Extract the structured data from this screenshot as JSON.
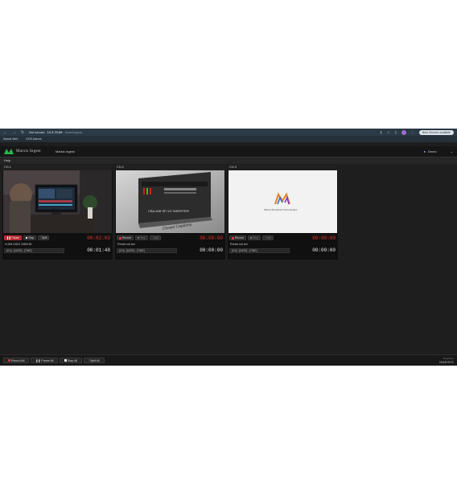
{
  "browser": {
    "nav_icons": [
      "back-icon",
      "forward-icon",
      "reload-icon"
    ],
    "security_text": "Not secure",
    "host": "10.3.70.69",
    "path": "/ltuse/ingest",
    "zoom_icon": "key-icon",
    "update_label": "New Chrome available",
    "bookmarks": [
      "Marsis Web",
      "DHS Alarms"
    ]
  },
  "app": {
    "brand": "Marsis Ingest",
    "title": "Marsis Ingest",
    "user": "Demo",
    "menu": "Help"
  },
  "channels": [
    {
      "title": "CH-1",
      "record_label": "Pause",
      "stop_label": "Stop",
      "split_label": "Split",
      "timer": "00:02:03",
      "preset": "H.264 HIGH 1080i 50",
      "format": "[CH] - [DATE] - [TIME]",
      "elapsed": "00:01:48",
      "recording": true
    },
    {
      "title": "CH-2",
      "record_label": "Record",
      "stop_label": "Stop",
      "split_label": "Split",
      "timer": "00:00:00",
      "preset": "Preset not set",
      "format": "[CH] - [DATE] - [TIME]",
      "elapsed": "00:00:00",
      "recording": false
    },
    {
      "title": "CH-3",
      "record_label": "Record",
      "stop_label": "Stop",
      "split_label": "Split",
      "timer": "00:00:00",
      "preset": "Preset not set",
      "format": "[CH] - [DATE] - [TIME]",
      "elapsed": "00:00:00",
      "recording": false
    }
  ],
  "previews": {
    "ch2_caption": "Closed Captions",
    "ch2_product": "CBA-608 SP-1/2 INSERTER",
    "ch3_logo_text": "Marsis Broadcast Technologies"
  },
  "footer": {
    "record_all": "Record All",
    "pause_all": "Pause All",
    "stop_all": "Stop All",
    "split_all": "Split All",
    "powered_by": "Powered by",
    "powered_brand": "MARSIS"
  },
  "colors": {
    "record_red": "#e0362f",
    "accent_green": "#2bb34a"
  }
}
